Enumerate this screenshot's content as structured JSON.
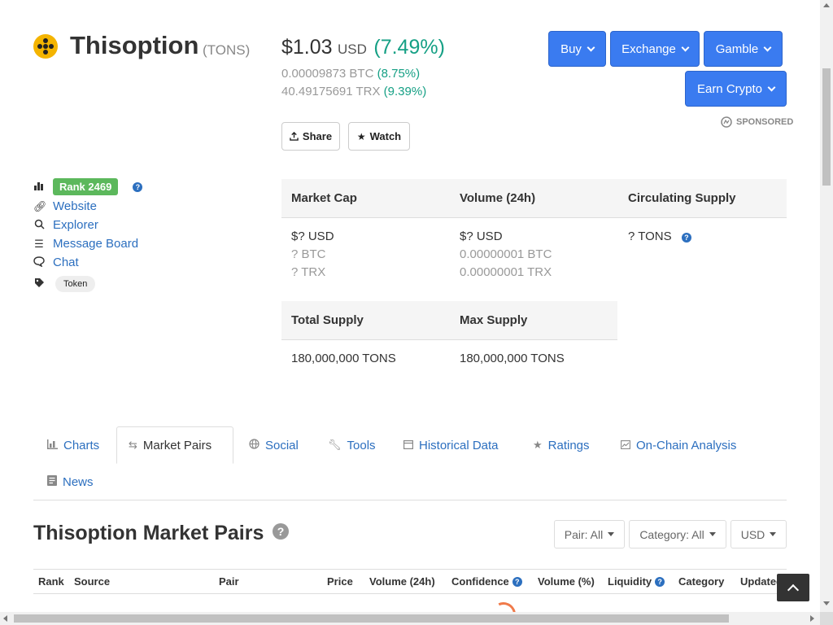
{
  "coin": {
    "name": "Thisoption",
    "symbol": "(TONS)",
    "logo_color": "#f4b400"
  },
  "price": {
    "value": "$1.03",
    "unit": "USD",
    "change": "(7.49%)",
    "btc_value": "0.00009873 BTC",
    "btc_change": "(8.75%)",
    "trx_value": "40.49175691 TRX",
    "trx_change": "(9.39%)",
    "change_color": "#16a085"
  },
  "actions": {
    "share_label": "Share",
    "watch_label": "Watch"
  },
  "header_buttons": {
    "buy": "Buy",
    "exchange": "Exchange",
    "gamble": "Gamble",
    "earn": "Earn Crypto",
    "sponsored": "SPONSORED",
    "color": "#3a7bf0"
  },
  "links": {
    "rank": "Rank 2469",
    "website": "Website",
    "explorer": "Explorer",
    "message_board": "Message Board",
    "chat": "Chat",
    "tag": "Token"
  },
  "stats": {
    "market_cap": {
      "label": "Market Cap",
      "usd": "$? USD",
      "btc": "? BTC",
      "trx": "? TRX"
    },
    "volume": {
      "label": "Volume (24h)",
      "usd": "$? USD",
      "btc": "0.00000001 BTC",
      "trx": "0.00000001 TRX"
    },
    "circulating": {
      "label": "Circulating Supply",
      "value": "? TONS"
    },
    "total_supply": {
      "label": "Total Supply",
      "value": "180,000,000 TONS"
    },
    "max_supply": {
      "label": "Max Supply",
      "value": "180,000,000 TONS"
    }
  },
  "tabs": [
    {
      "label": "Charts",
      "icon": "bar-chart-icon"
    },
    {
      "label": "Market Pairs",
      "icon": "swap-icon",
      "active": true
    },
    {
      "label": "Social",
      "icon": "globe-icon"
    },
    {
      "label": "Tools",
      "icon": "wrench-icon"
    },
    {
      "label": "Historical Data",
      "icon": "calendar-icon"
    },
    {
      "label": "Ratings",
      "icon": "star-icon"
    },
    {
      "label": "On-Chain Analysis",
      "icon": "line-chart-icon"
    },
    {
      "label": "News",
      "icon": "newspaper-icon"
    }
  ],
  "market_pairs": {
    "title": "Thisoption Market Pairs",
    "filters": {
      "pair": "Pair: All",
      "category": "Category: All",
      "currency": "USD"
    },
    "columns": [
      "Rank",
      "Source",
      "Pair",
      "Price",
      "Volume (24h)",
      "Confidence",
      "Volume (%)",
      "Liquidity",
      "Category",
      "Updated"
    ]
  }
}
